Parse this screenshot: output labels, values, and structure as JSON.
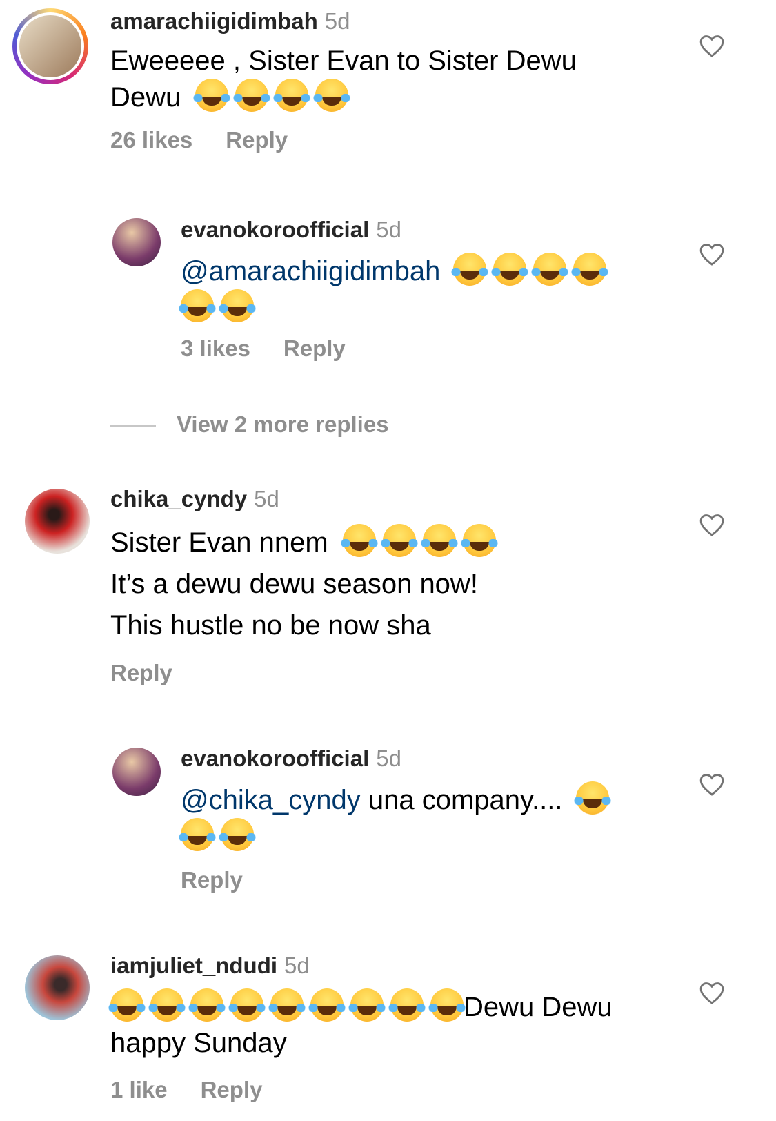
{
  "comments": [
    {
      "username": "amarachiigidimbah",
      "time": "5d",
      "text_before": "Eweeeee , Sister Evan to Sister Dewu",
      "text_line2": "Dewu",
      "likes": "26 likes",
      "reply": "Reply"
    },
    {
      "username": "evanokoroofficial",
      "time": "5d",
      "mention": "@amarachiigidimbah",
      "likes": "3 likes",
      "reply": "Reply"
    },
    {
      "username": "chika_cyndy",
      "time": "5d",
      "line1": "Sister Evan nnem",
      "line2": "It’s a dewu dewu season now!",
      "line3": "This hustle no be now sha",
      "reply": "Reply"
    },
    {
      "username": "evanokoroofficial",
      "time": "5d",
      "mention": "@chika_cyndy",
      "text": " una company....",
      "reply": "Reply"
    },
    {
      "username": "iamjuliet_ndudi",
      "time": "5d",
      "text_after_emoji": "Dewu Dewu",
      "line2": "happy Sunday",
      "likes": "1 like",
      "reply": "Reply"
    }
  ],
  "view_more_replies": "View 2 more replies",
  "icons": {
    "like": "heart-outline-icon",
    "emoji": "face-with-tears-of-joy-emoji"
  }
}
